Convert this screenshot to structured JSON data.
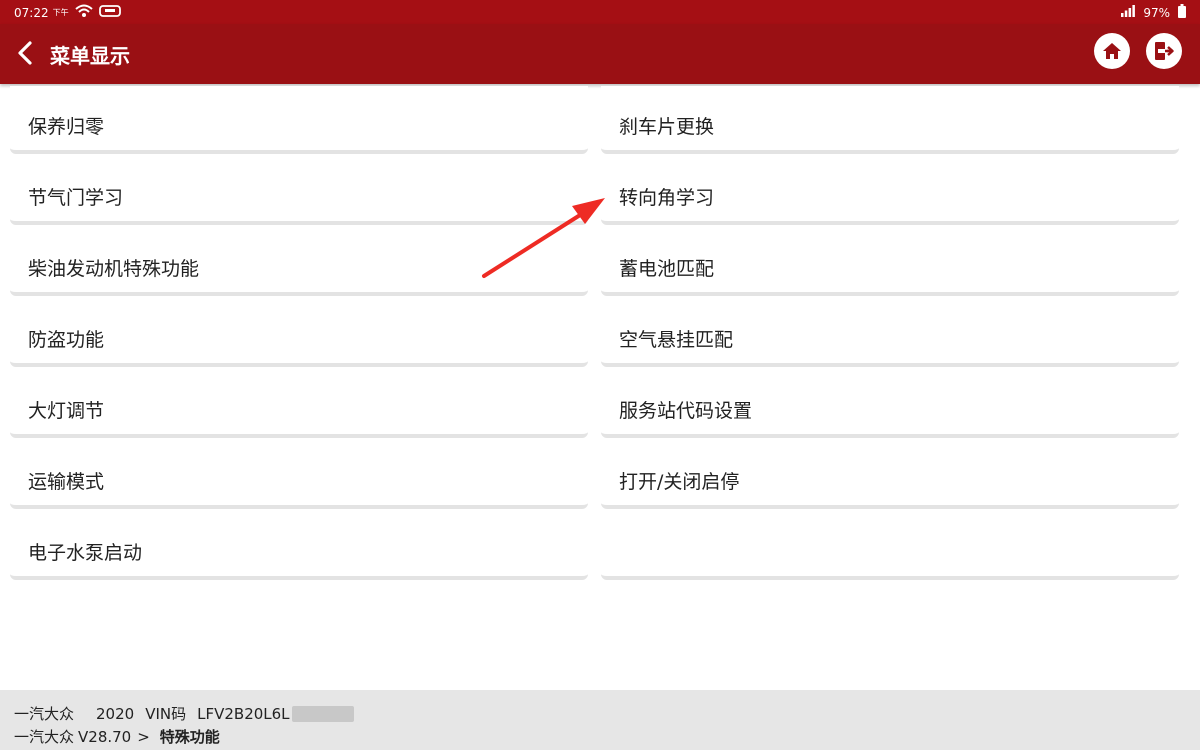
{
  "status": {
    "time": "07:22",
    "ampm": "下午",
    "battery": "97%"
  },
  "titlebar": {
    "title": "菜单显示"
  },
  "menu": {
    "left": [
      "保养归零",
      "节气门学习",
      "柴油发动机特殊功能",
      "防盗功能",
      "大灯调节",
      "运输模式",
      "电子水泵启动"
    ],
    "right": [
      "刹车片更换",
      "转向角学习",
      "蓄电池匹配",
      "空气悬挂匹配",
      "服务站代码设置",
      "打开/关闭启停"
    ]
  },
  "footer": {
    "brand": "一汽大众",
    "year": "2020",
    "vin_label": "VIN码",
    "vin": "LFV2B20L6L",
    "path_brand": "一汽大众",
    "version": "V28.70",
    "separator": ">",
    "path_current": "特殊功能"
  },
  "colors": {
    "header": "#9a1014",
    "statusbar": "#a50f14",
    "arrow": "#ee2b24"
  }
}
